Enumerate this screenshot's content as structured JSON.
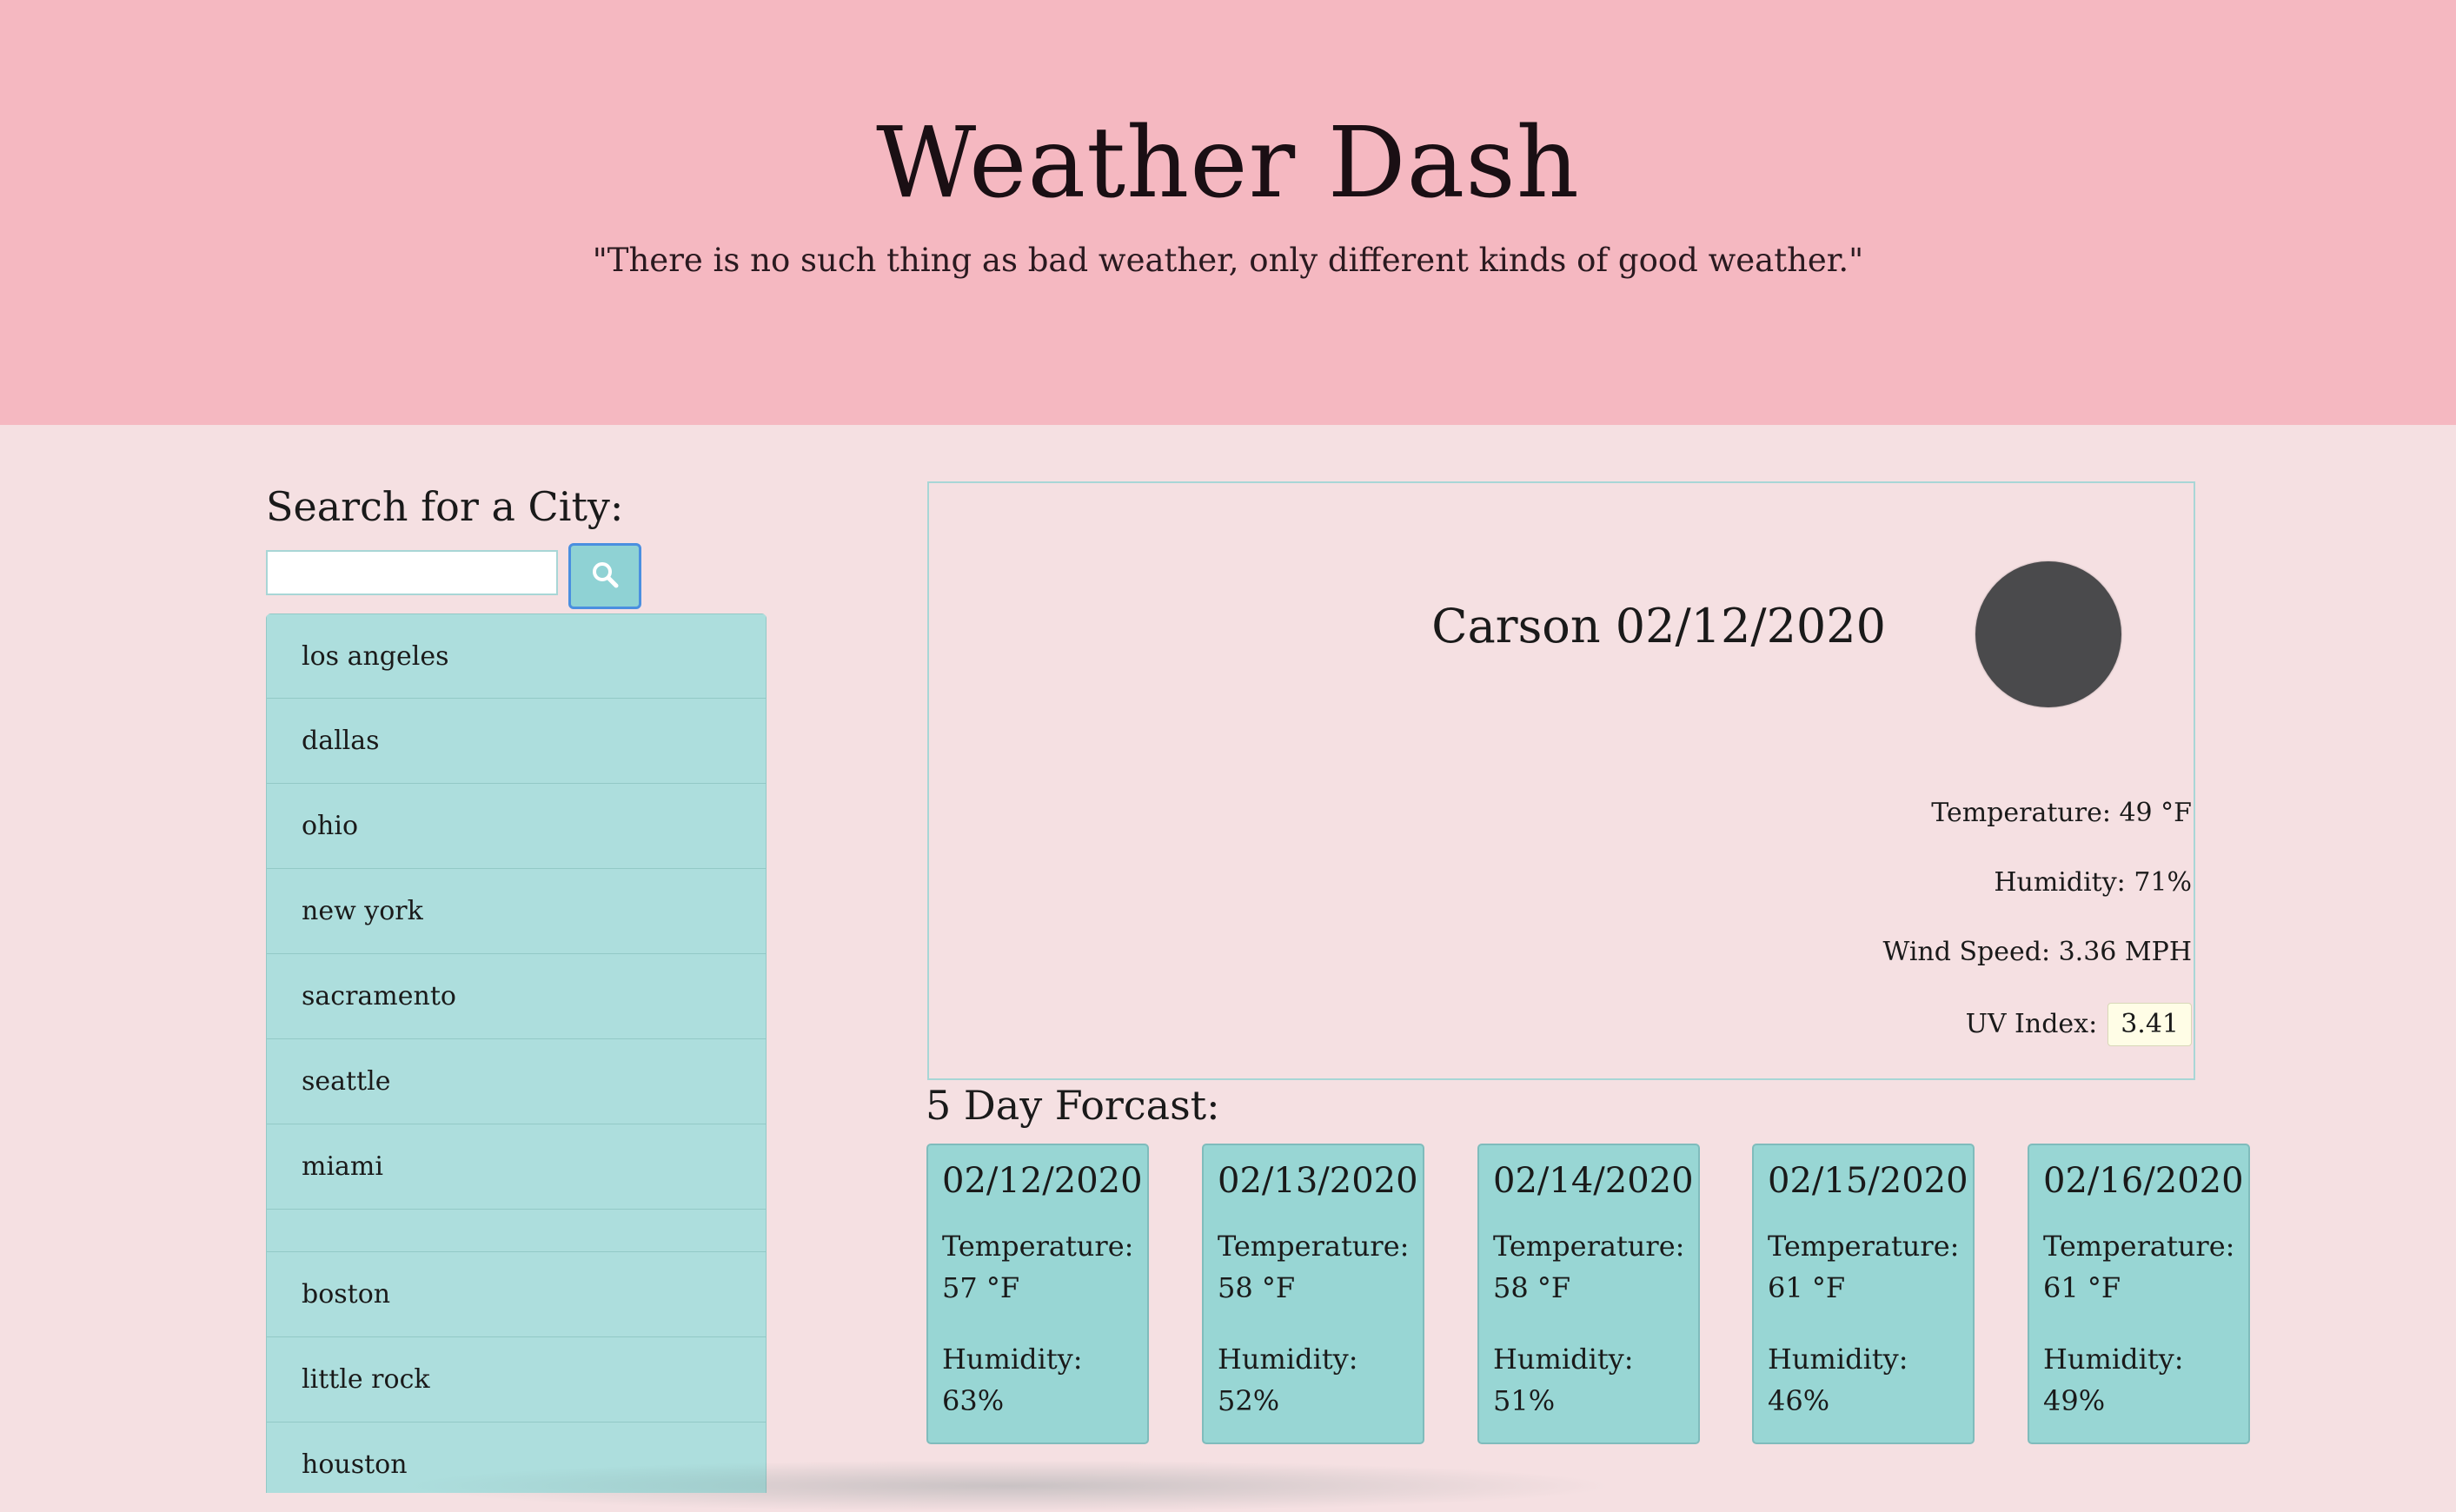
{
  "header": {
    "title": "Weather Dash",
    "quote": "\"There is no such thing as bad weather, only different kinds of good weather.\""
  },
  "search": {
    "label": "Search for a City:",
    "input_value": "",
    "placeholder": "",
    "button_icon": "search-icon"
  },
  "history": {
    "items": [
      {
        "label": "los angeles"
      },
      {
        "label": "dallas"
      },
      {
        "label": "ohio"
      },
      {
        "label": "new york"
      },
      {
        "label": "sacramento"
      },
      {
        "label": "seattle"
      },
      {
        "label": "miami"
      },
      {
        "label": ""
      },
      {
        "label": "boston"
      },
      {
        "label": "little rock"
      },
      {
        "label": "houston"
      }
    ]
  },
  "current": {
    "city_date": "Carson 02/12/2020",
    "icon": "weather-icon",
    "temperature": "Temperature: 49 °F",
    "humidity": "Humidity: 71%",
    "wind": "Wind Speed: 3.36 MPH",
    "uv_label": "UV Index:",
    "uv_value": "3.41"
  },
  "forecast": {
    "heading": "5 Day Forcast:",
    "days": [
      {
        "date": "02/12/2020",
        "temp_label": "Temperature:",
        "temp": "57 °F",
        "hum_label": "Humidity:",
        "hum": "63%"
      },
      {
        "date": "02/13/2020",
        "temp_label": "Temperature:",
        "temp": "58 °F",
        "hum_label": "Humidity:",
        "hum": "52%"
      },
      {
        "date": "02/14/2020",
        "temp_label": "Temperature:",
        "temp": "58 °F",
        "hum_label": "Humidity:",
        "hum": "51%"
      },
      {
        "date": "02/15/2020",
        "temp_label": "Temperature:",
        "temp": "61 °F",
        "hum_label": "Humidity:",
        "hum": "46%"
      },
      {
        "date": "02/16/2020",
        "temp_label": "Temperature:",
        "temp": "61 °F",
        "hum_label": "Humidity:",
        "hum": "49%"
      }
    ]
  },
  "colors": {
    "header_bg": "#f5b8c1",
    "page_bg": "#f5e0e2",
    "list_bg": "#addedd",
    "card_bg": "#98d6d4",
    "uv_bg": "#fffde6",
    "icon_bg": "#4a4a4c"
  }
}
